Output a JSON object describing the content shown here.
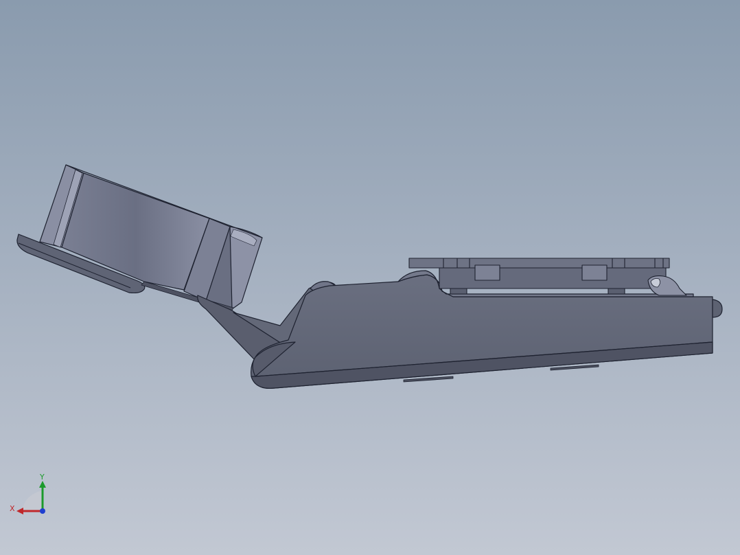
{
  "graphics_area": {
    "background_top": "#8a9bae",
    "background_bottom": "#c2c8d3",
    "model_colors": {
      "face_dark": "#5d6272",
      "face_mid": "#6b7081",
      "face_light": "#8a8fa3",
      "edge": "#1e2230"
    }
  },
  "triad": {
    "x_label": "X",
    "y_label": "Y",
    "x_color": "#c0282b",
    "y_color": "#1c9a2c",
    "z_color": "#1f3fd0"
  }
}
